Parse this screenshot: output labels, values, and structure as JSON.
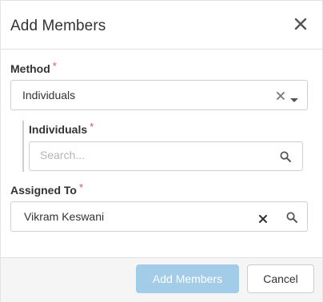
{
  "dialog": {
    "title": "Add Members",
    "close_icon": "close-icon"
  },
  "method": {
    "label": "Method",
    "required_mark": "*",
    "value": "Individuals",
    "clear_icon": "clear-icon",
    "dropdown_icon": "chevron-down-icon"
  },
  "individuals": {
    "label": "Individuals",
    "required_mark": "*",
    "placeholder": "Search...",
    "search_icon": "search-icon"
  },
  "assigned_to": {
    "label": "Assigned To",
    "required_mark": "*",
    "value": "Vikram Keswani",
    "clear_icon": "clear-icon",
    "search_icon": "search-icon"
  },
  "footer": {
    "primary_label": "Add Members",
    "cancel_label": "Cancel"
  },
  "colors": {
    "primary_button": "#a3cce9",
    "required": "#d9534f"
  }
}
